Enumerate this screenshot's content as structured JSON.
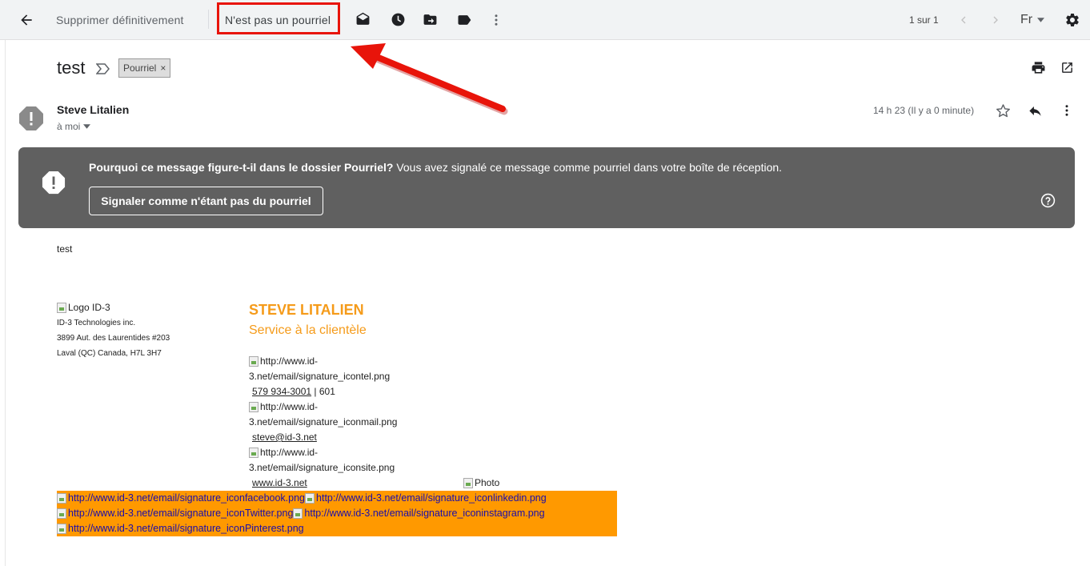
{
  "toolbar": {
    "delete_forever": "Supprimer définitivement",
    "not_spam": "N'est pas un pourriel",
    "pagination": "1 sur 1",
    "language": "Fr"
  },
  "email": {
    "subject": "test",
    "label": "Pourriel",
    "sender_name": "Steve Litalien",
    "recipient": "à moi",
    "time": "14 h 23 (Il y a 0 minute)"
  },
  "banner": {
    "question": "Pourquoi ce message figure-t-il dans le dossier Pourriel?",
    "explanation": " Vous avez signalé ce message comme pourriel dans votre boîte de réception.",
    "button": "Signaler comme n'étant pas du pourriel"
  },
  "body": {
    "text": "test"
  },
  "signature": {
    "logo_alt": "Logo ID-3",
    "company": "ID-3 Technologies inc.",
    "address1": "3899 Aut. des Laurentides #203",
    "address2": "Laval (QC) Canada, H7L 3H7",
    "name": "STEVE LITALIEN",
    "role": "Service à la clientèle",
    "tel_alt_1": "http://www.id-",
    "tel_alt_2": "3.net/email/signature_icontel.png",
    "phone": "579 934-3001",
    "ext": " | 601",
    "mail_alt_1": "http://www.id-",
    "mail_alt_2": "3.net/email/signature_iconmail.png",
    "email": "steve@id-3.net",
    "site_alt_1": "http://www.id-",
    "site_alt_2": "3.net/email/signature_iconsite.png",
    "website": "www.id-3.net",
    "photo_alt": "Photo",
    "facebook": "http://www.id-3.net/email/signature_iconfacebook.png",
    "linkedin": "http://www.id-3.net/email/signature_iconlinkedin.png",
    "twitter": "http://www.id-3.net/email/signature_iconTwitter.png",
    "instagram": "http://www.id-3.net/email/signature_iconinstagram.png",
    "pinterest": "http://www.id-3.net/email/signature_iconPinterest.png"
  },
  "colors": {
    "annotation_red": "#e8140a",
    "banner_gray": "#606060",
    "signature_orange": "#ff9900",
    "toolbar_bg": "#f1f3f4"
  },
  "icons": {
    "back": "arrow-left-icon",
    "mark_unread": "envelope-open-icon",
    "snooze": "clock-icon",
    "move": "folder-move-icon",
    "label": "label-icon",
    "more": "more-vertical-icon",
    "settings": "gear-icon",
    "print": "printer-icon",
    "open_new": "open-in-new-icon",
    "star": "star-icon",
    "reply": "reply-icon",
    "warning": "exclamation-icon",
    "help": "help-icon"
  }
}
